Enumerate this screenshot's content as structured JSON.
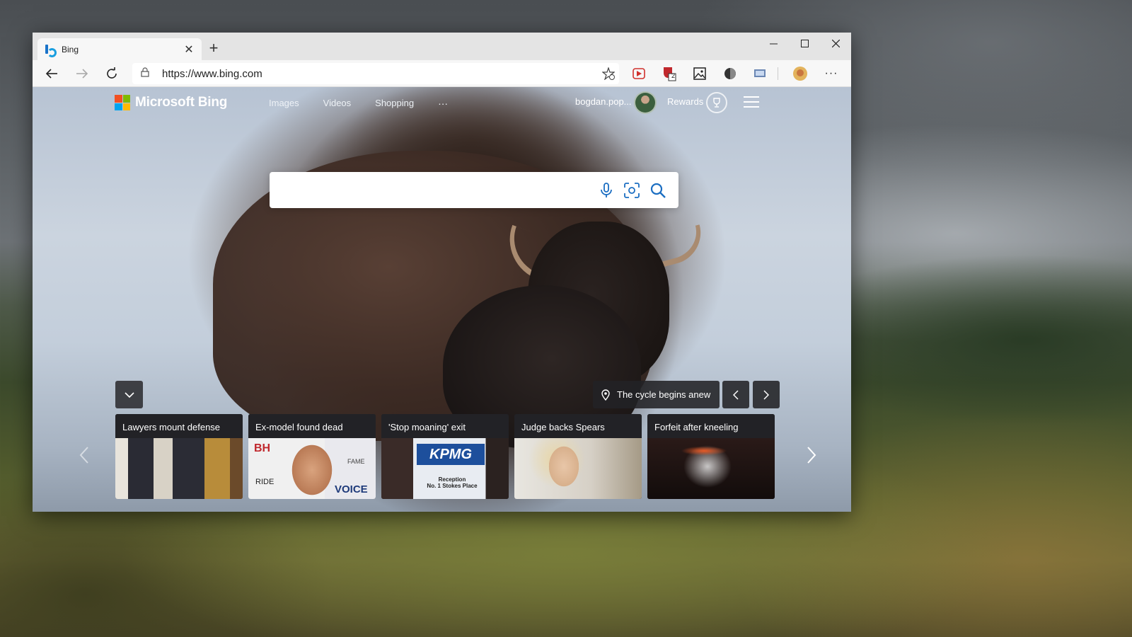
{
  "browser": {
    "tab_title": "Bing",
    "tab_close": "✕",
    "new_tab": "+",
    "url": "https://www.bing.com",
    "window_controls": [
      "─",
      "☐",
      "✕"
    ],
    "more_menu": "···",
    "extension_badge": "2"
  },
  "bing": {
    "logo_text": "Microsoft Bing",
    "nav": [
      "Images",
      "Videos",
      "Shopping"
    ],
    "nav_more": "···",
    "user_name": "bogdan.pop...",
    "rewards_label": "Rewards",
    "search_placeholder": "",
    "location_text": "The cycle begins anew",
    "news": [
      {
        "title": "Lawyers mount defense"
      },
      {
        "title": "Ex-model found dead"
      },
      {
        "title": "'Stop moaning' exit"
      },
      {
        "title": "Judge backs Spears"
      },
      {
        "title": "Forfeit after kneeling"
      }
    ],
    "news_image_text": {
      "kpmg_logo": "KPMG",
      "kpmg_sign": "Reception\nNo. 1 Stokes Place",
      "voice": "VOICE",
      "bh": "BH",
      "ride": "RIDE",
      "fame": "FAME"
    }
  },
  "colors": {
    "ms_red": "#f25022",
    "ms_green": "#7fba00",
    "ms_blue": "#00a4ef",
    "ms_yellow": "#ffb900",
    "bing_icon_blue": "#1a73c9"
  },
  "icons": {
    "back": "back-arrow-icon",
    "forward": "forward-arrow-icon",
    "refresh": "refresh-icon",
    "lock": "lock-icon",
    "favorite": "favorite-star-icon",
    "mic": "microphone-icon",
    "visual_search": "visual-search-icon",
    "search": "search-icon"
  }
}
